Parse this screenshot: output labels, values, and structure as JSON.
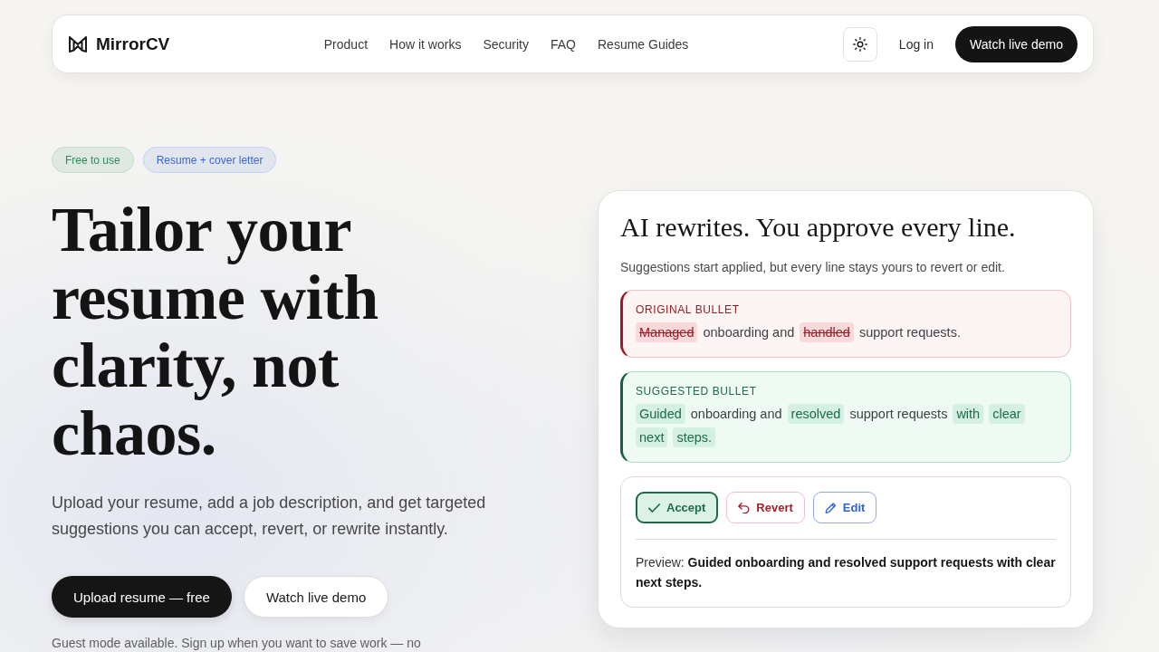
{
  "nav": {
    "logo": "MirrorCV",
    "links": [
      "Product",
      "How it works",
      "Security",
      "FAQ",
      "Resume Guides"
    ],
    "login": "Log in",
    "cta": "Watch live demo"
  },
  "hero": {
    "badges": [
      {
        "label": "Free to use",
        "color": "#2e8a5c"
      },
      {
        "label": "Resume + cover letter",
        "color": "#3767dc"
      }
    ],
    "headline": "Tailor your resume with clarity, not chaos.",
    "description": "Upload your resume, add a job description, and get targeted suggestions you can accept, revert, or rewrite instantly.",
    "buttons": [
      {
        "label": "Upload resume — free",
        "kind": "primary"
      },
      {
        "label": "Watch live demo",
        "kind": "secondary"
      }
    ],
    "note": "Guest mode available. Sign up when you want to save work — no"
  },
  "demo_card": {
    "title": "AI rewrites. You approve every line.",
    "subtitle": "Suggestions start applied, but every line stays yours to revert or edit.",
    "bullets": [
      {
        "kind": "original",
        "label": "ORIGINAL BULLET",
        "segments": [
          {
            "text": "Managed",
            "changed": true
          },
          {
            "text": "onboarding and",
            "changed": false
          },
          {
            "text": "handled",
            "changed": true
          },
          {
            "text": "support requests.",
            "changed": false
          }
        ]
      },
      {
        "kind": "suggested",
        "label": "SUGGESTED BULLET",
        "segments": [
          {
            "text": "Guided",
            "changed": true
          },
          {
            "text": "onboarding and",
            "changed": false
          },
          {
            "text": "resolved",
            "changed": true
          },
          {
            "text": "support requests",
            "changed": false
          },
          {
            "text": "with",
            "changed": true
          },
          {
            "text": "clear",
            "changed": true
          },
          {
            "text": "next",
            "changed": true
          },
          {
            "text": "steps.",
            "changed": true
          }
        ]
      }
    ],
    "actions": [
      {
        "label": "Accept",
        "kind": "accept",
        "selected": true
      },
      {
        "label": "Revert",
        "kind": "revert",
        "selected": false
      },
      {
        "label": "Edit",
        "kind": "edit",
        "selected": false
      }
    ],
    "preview": "Preview: **Guided onboarding and resolved support requests with clear next steps.**"
  }
}
